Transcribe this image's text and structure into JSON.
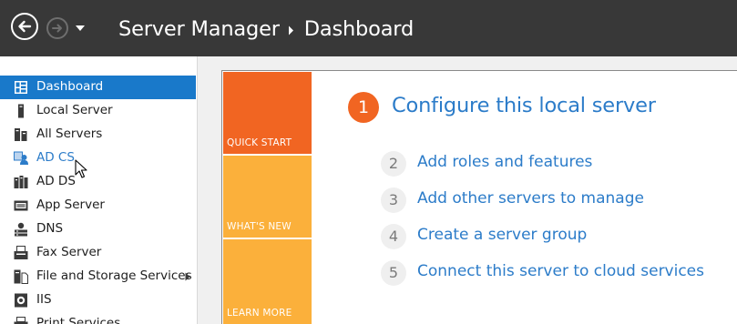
{
  "window": {
    "breadcrumb": {
      "root": "Server Manager",
      "current": "Dashboard"
    }
  },
  "sidebar": {
    "items": [
      {
        "label": "Dashboard",
        "icon": "dashboard-icon"
      },
      {
        "label": "Local Server",
        "icon": "server-icon"
      },
      {
        "label": "All Servers",
        "icon": "servers-icon"
      },
      {
        "label": "AD CS",
        "icon": "certificate-users-icon"
      },
      {
        "label": "AD DS",
        "icon": "directory-icon"
      },
      {
        "label": "App Server",
        "icon": "app-server-icon"
      },
      {
        "label": "DNS",
        "icon": "dns-icon"
      },
      {
        "label": "Fax Server",
        "icon": "fax-icon"
      },
      {
        "label": "File and Storage Services",
        "icon": "file-storage-icon"
      },
      {
        "label": "IIS",
        "icon": "iis-icon"
      },
      {
        "label": "Print Services",
        "icon": "printer-icon"
      }
    ]
  },
  "welcome": {
    "tiles": {
      "quick_start": "QUICK START",
      "whats_new": "WHAT'S NEW",
      "learn_more": "LEARN MORE"
    },
    "configure": {
      "number": "1",
      "title": "Configure this local server"
    },
    "steps": [
      {
        "number": "2",
        "label": "Add roles and features"
      },
      {
        "number": "3",
        "label": "Add other servers to manage"
      },
      {
        "number": "4",
        "label": "Create a server group"
      },
      {
        "number": "5",
        "label": "Connect this server to cloud services"
      }
    ]
  },
  "colors": {
    "titlebar": "#383838",
    "accent_blue": "#1979ca",
    "link_blue": "#2c7cc9",
    "quick_start_orange": "#f16522",
    "tile_yellow": "#fbb03b"
  }
}
